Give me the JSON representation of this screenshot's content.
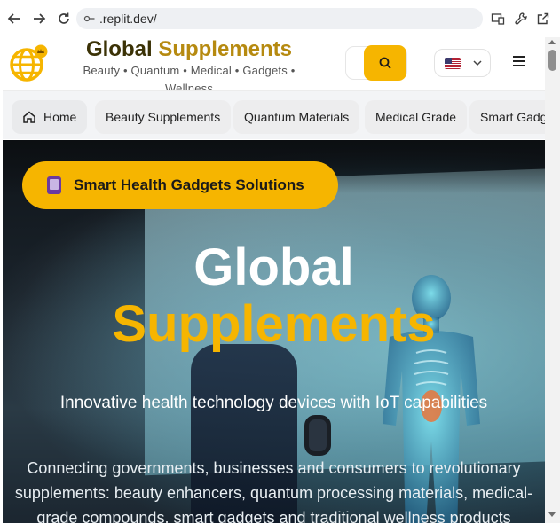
{
  "browser": {
    "url": ".replit.dev/"
  },
  "header": {
    "title_part1": "Global",
    "title_part2": "Supplements",
    "subtitle": "Beauty • Quantum • Medical • Gadgets • Wellness",
    "language_flag": "us-flag-icon"
  },
  "categories": [
    {
      "label": "Home",
      "icon": "home-icon"
    },
    {
      "label": "Beauty Supplements"
    },
    {
      "label": "Quantum Materials"
    },
    {
      "label": "Medical Grade"
    },
    {
      "label": "Smart Gadgets"
    }
  ],
  "hero": {
    "badge": "Smart Health Gadgets Solutions",
    "badge_icon": "mobile-phone-icon",
    "title_line1": "Global",
    "title_line2": "Supplements",
    "tagline": "Innovative health technology devices with IoT capabilities",
    "description": "Connecting governments, businesses and consumers to revolutionary supplements: beauty enhancers, quantum processing materials, medical-grade compounds, smart gadgets and traditional wellness products"
  },
  "colors": {
    "accent": "#f6b500",
    "title_dark": "#3b3206",
    "title_gold": "#b68a10"
  }
}
